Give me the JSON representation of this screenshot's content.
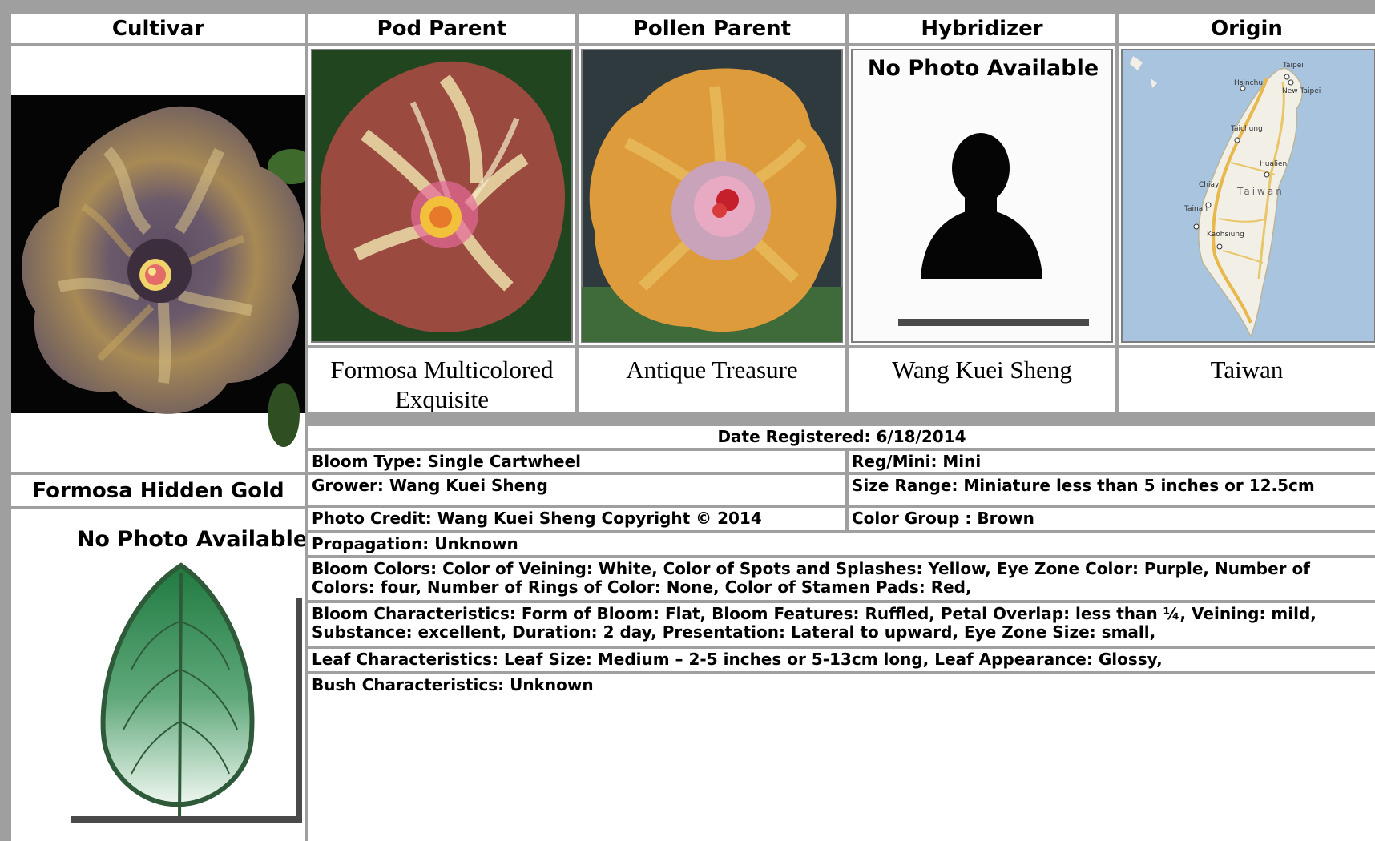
{
  "headers": {
    "cultivar": "Cultivar",
    "pod_parent": "Pod Parent",
    "pollen_parent": "Pollen Parent",
    "hybridizer": "Hybridizer",
    "origin": "Origin"
  },
  "parents": {
    "pod_parent_name": "Formosa Multicolored Exquisite",
    "pollen_parent_name": "Antique Treasure",
    "hybridizer_name": "Wang Kuei Sheng",
    "origin_name": "Taiwan"
  },
  "placeholders": {
    "hybridizer_photo": "No Photo Available",
    "leaf_photo": "No Photo Available"
  },
  "map_labels": {
    "taipei": "Taipei",
    "hsinchu": "Hsinchu",
    "new_taipei": "New Taipei",
    "taichung": "Taichung",
    "hualien": "Hualien",
    "chiayi": "Chiayi",
    "taiwan": "Taiwan",
    "tainan": "Tainan",
    "kaohsiung": "Kaohsiung"
  },
  "cultivar_name": "Formosa Hidden Gold",
  "details": {
    "date_registered": "Date Registered:  6/18/2014",
    "bloom_type": "Bloom Type: Single Cartwheel",
    "reg_mini": "Reg/Mini: Mini",
    "grower": "Grower: Wang Kuei Sheng",
    "size_range": "Size Range: Miniature less than 5 inches or 12.5cm",
    "photo_credit": "Photo Credit: Wang Kuei Sheng Copyright © 2014",
    "color_group": "Color Group : Brown",
    "propagation": "Propagation: Unknown",
    "bloom_colors": "Bloom Colors: Color of Veining: White, Color of Spots and Splashes: Yellow, Eye Zone Color: Purple, Number of Colors: four, Number of Rings of Color: None, Color of Stamen Pads: Red,",
    "bloom_characteristics": "Bloom Characteristics: Form of Bloom: Flat, Bloom Features: Ruffled, Petal Overlap: less than ¼, Veining: mild, Substance: excellent, Duration: 2 day, Presentation: Lateral to upward, Eye Zone Size: small,",
    "leaf_characteristics": "Leaf Characteristics: Leaf Size: Medium – 2-5 inches or 5-13cm long, Leaf Appearance: Glossy,",
    "bush_characteristics": "Bush Characteristics: Unknown"
  }
}
